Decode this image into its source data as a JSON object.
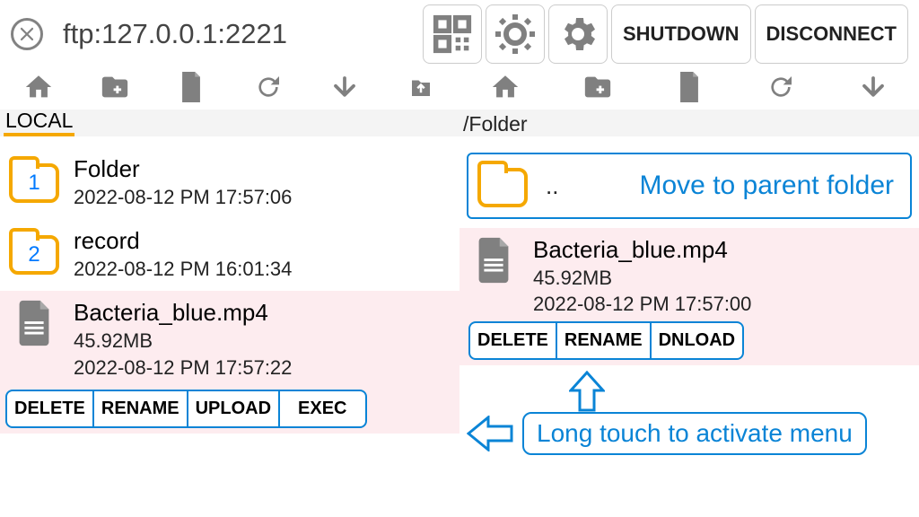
{
  "header": {
    "address": "ftp:127.0.0.1:2221",
    "shutdown": "SHUTDOWN",
    "disconnect": "DISCONNECT"
  },
  "local": {
    "path_label": "LOCAL",
    "items": [
      {
        "type": "folder",
        "num": "1",
        "name": "Folder",
        "date": "2022-08-12 PM 17:57:06"
      },
      {
        "type": "folder",
        "num": "2",
        "name": "record",
        "date": "2022-08-12 PM 16:01:34"
      },
      {
        "type": "file",
        "name": "Bacteria_blue.mp4",
        "size": "45.92MB",
        "date": "2022-08-12 PM 17:57:22"
      }
    ],
    "actions": {
      "delete": "DELETE",
      "rename": "RENAME",
      "upload": "UPLOAD",
      "exec": "EXEC"
    }
  },
  "remote": {
    "path_label": "/Folder",
    "parent": {
      "dots": "..",
      "label": "Move to parent folder"
    },
    "items": [
      {
        "type": "file",
        "name": "Bacteria_blue.mp4",
        "size": "45.92MB",
        "date": "2022-08-12 PM 17:57:00"
      }
    ],
    "actions": {
      "delete": "DELETE",
      "rename": "RENAME",
      "dnload": "DNLOAD"
    },
    "hint": "Long touch to activate menu"
  }
}
